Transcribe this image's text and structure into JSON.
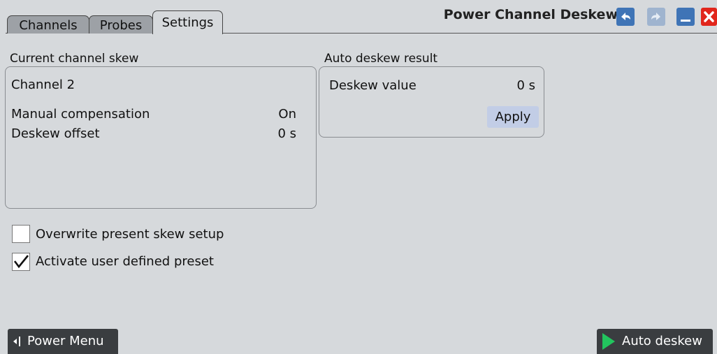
{
  "window": {
    "title": "Power Channel Deskew",
    "icons": [
      "undo-icon",
      "redo-icon",
      "minimize-icon",
      "close-icon"
    ]
  },
  "tabs": [
    {
      "label": "Channels",
      "active": false
    },
    {
      "label": "Probes",
      "active": false
    },
    {
      "label": "Settings",
      "active": true
    }
  ],
  "current_skew": {
    "title": "Current channel skew",
    "channel": "Channel 2",
    "manual_compensation_label": "Manual compensation",
    "manual_compensation_value": "On",
    "deskew_offset_label": "Deskew offset",
    "deskew_offset_value": "0 s"
  },
  "auto_result": {
    "title": "Auto deskew result",
    "deskew_value_label": "Deskew value",
    "deskew_value": "0 s",
    "apply_label": "Apply"
  },
  "options": {
    "overwrite_label": "Overwrite present skew setup",
    "overwrite_checked": false,
    "activate_label": "Activate user defined preset",
    "activate_checked": true
  },
  "bottom": {
    "power_menu_label": "Power Menu",
    "auto_deskew_label": "Auto deskew"
  },
  "colors": {
    "background": "#d6d9dc",
    "apply_button": "#c2cde6",
    "bottom_button": "#3a3d40",
    "play_green": "#22c55e",
    "close_red": "#e1261c",
    "window_button_blue": "#3f74b6"
  }
}
